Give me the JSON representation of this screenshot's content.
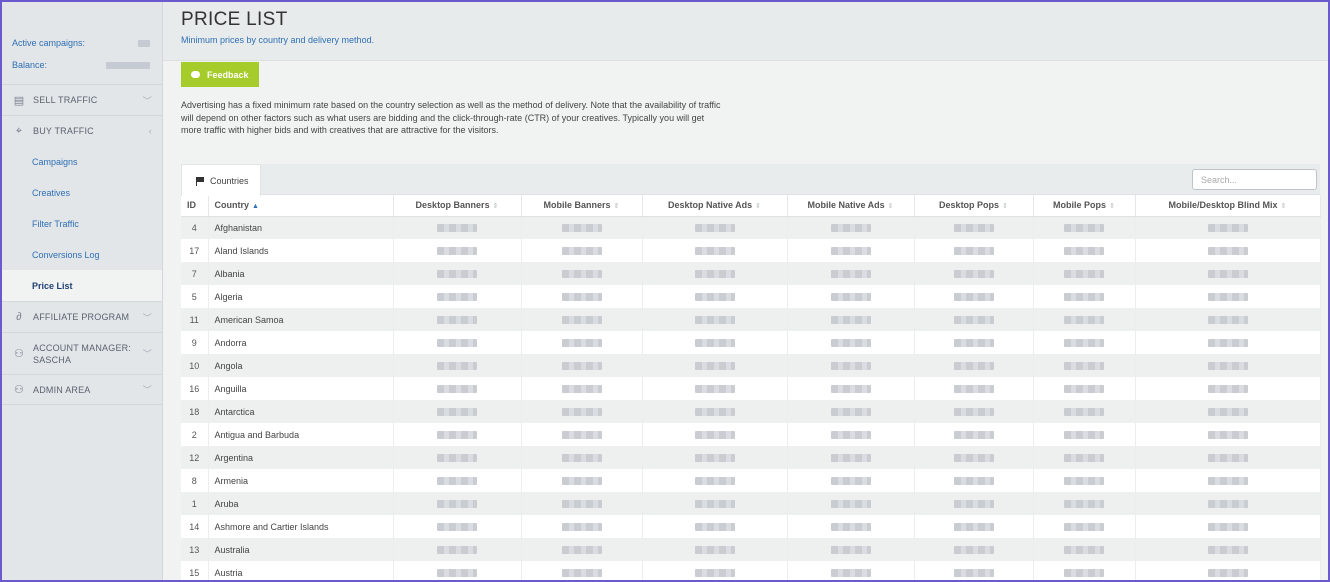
{
  "account": {
    "active_campaigns_label": "Active campaigns:",
    "balance_label": "Balance:"
  },
  "sidebar": {
    "items": [
      {
        "label": "SELL TRAFFIC",
        "icon": "layout-icon"
      },
      {
        "label": "BUY TRAFFIC",
        "icon": "crosshair-icon"
      },
      {
        "label": "AFFILIATE PROGRAM",
        "icon": "link-icon"
      },
      {
        "label": "ACCOUNT MANAGER: SASCHA",
        "icon": "user-icon"
      },
      {
        "label": "ADMIN AREA",
        "icon": "user-icon"
      }
    ],
    "sub_items": [
      "Campaigns",
      "Creatives",
      "Filter Traffic",
      "Conversions Log",
      "Price List"
    ],
    "active_sub_item": "Price List"
  },
  "page": {
    "title": "PRICE LIST",
    "subtitle": "Minimum prices by country and delivery method.",
    "feedback_label": "Feedback",
    "intro": "Advertising has a fixed minimum rate based on the country selection as well as the method of delivery. Note that the availability of traffic will depend on other factors such as what users are bidding and the click-through-rate (CTR) of your creatives. Typically you will get more traffic with higher bids and with creatives that are attractive for the visitors."
  },
  "table": {
    "tab_label": "Countries",
    "search_placeholder": "Search...",
    "columns": [
      "ID",
      "Country",
      "Desktop Banners",
      "Mobile Banners",
      "Desktop Native Ads",
      "Mobile Native Ads",
      "Desktop Pops",
      "Mobile Pops",
      "Mobile/Desktop Blind Mix"
    ],
    "rows": [
      {
        "id": "4",
        "country": "Afghanistan"
      },
      {
        "id": "17",
        "country": "Aland Islands"
      },
      {
        "id": "7",
        "country": "Albania"
      },
      {
        "id": "5",
        "country": "Algeria"
      },
      {
        "id": "11",
        "country": "American Samoa"
      },
      {
        "id": "9",
        "country": "Andorra"
      },
      {
        "id": "10",
        "country": "Angola"
      },
      {
        "id": "16",
        "country": "Anguilla"
      },
      {
        "id": "18",
        "country": "Antarctica"
      },
      {
        "id": "2",
        "country": "Antigua and Barbuda"
      },
      {
        "id": "12",
        "country": "Argentina"
      },
      {
        "id": "8",
        "country": "Armenia"
      },
      {
        "id": "1",
        "country": "Aruba"
      },
      {
        "id": "14",
        "country": "Ashmore and Cartier Islands"
      },
      {
        "id": "13",
        "country": "Australia"
      },
      {
        "id": "15",
        "country": "Austria"
      }
    ]
  },
  "colors": {
    "accent_green": "#a5cc2a",
    "link_blue": "#2f6fb4",
    "frame": "#6a5acd"
  }
}
